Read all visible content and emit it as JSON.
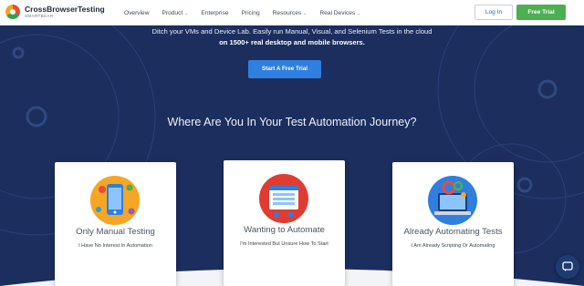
{
  "header": {
    "logo_name": "CrossBrowserTesting",
    "logo_sub": "SMARTBEAR",
    "nav": [
      {
        "label": "Overview",
        "caret": false
      },
      {
        "label": "Product",
        "caret": true
      },
      {
        "label": "Enterprise",
        "caret": false
      },
      {
        "label": "Pricing",
        "caret": false
      },
      {
        "label": "Resources",
        "caret": true
      },
      {
        "label": "Real Devices",
        "caret": true
      }
    ],
    "login_label": "Log In",
    "trial_label": "Free Trial"
  },
  "hero": {
    "tagline_1": "Ditch your VMs and Device Lab. Easily run Manual, Visual, and Selenium Tests in the cloud",
    "tagline_2": "on 1500+ real desktop and mobile browsers.",
    "cta_label": "Start A Free Trial",
    "journey_title": "Where Are You In Your Test Automation Journey?"
  },
  "cards": [
    {
      "title": "Only Manual Testing",
      "subtitle": "I Have No Interest In Automation",
      "icon": "mobile-phone-icon"
    },
    {
      "title": "Wanting to Automate",
      "subtitle": "I'm Interested But Unsure How To Start",
      "icon": "browser-window-icon"
    },
    {
      "title": "Already Automating Tests",
      "subtitle": "I Am Already Scripting Or Automating",
      "icon": "laptop-gears-icon"
    }
  ],
  "colors": {
    "hero_bg": "#1b2e5e",
    "cta": "#2f7fe0",
    "trial_button": "#4caf50",
    "login_text": "#2a68b8"
  }
}
